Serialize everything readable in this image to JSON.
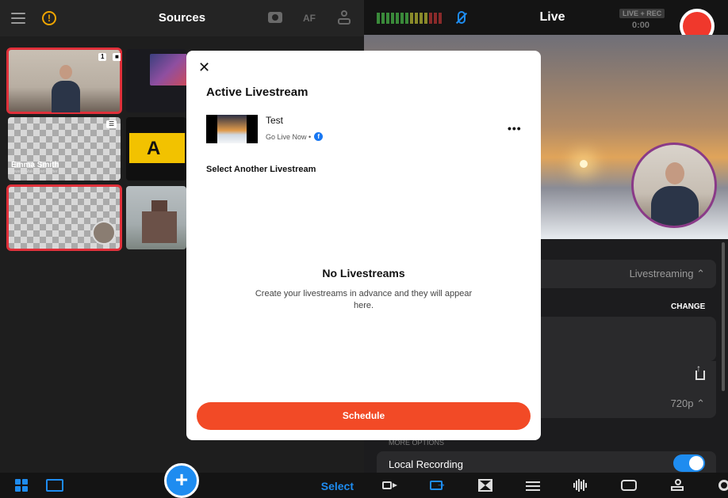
{
  "sources_panel": {
    "title": "Sources",
    "af_label": "AF",
    "tiles": [
      {
        "badge_number": "1",
        "type": "camera"
      },
      {
        "type": "screen"
      },
      {
        "type": "lower-third",
        "name": "Emma Smith",
        "subtitle": "Jewelry Maker and Crafter"
      },
      {
        "type": "graphic",
        "letter": "A"
      },
      {
        "type": "pip"
      },
      {
        "type": "image"
      }
    ],
    "select_label": "Select",
    "add_symbol": "+"
  },
  "live_panel": {
    "title": "Live",
    "badge": "LIVE + REC",
    "timer": "0:00",
    "destination_value": "Livestreaming ⌃",
    "change_label": "CHANGE",
    "resolution_value": "720p ⌃",
    "more_options_label": "MORE OPTIONS",
    "local_recording_label": "Local Recording",
    "local_recording_on": true
  },
  "modal": {
    "close_symbol": "✕",
    "heading": "Active Livestream",
    "active_stream": {
      "title": "Test",
      "subtitle": "Go Live Now •",
      "platform_icon": "facebook-icon"
    },
    "more_symbol": "•••",
    "section_heading": "Select Another Livestream",
    "empty_title": "No Livestreams",
    "empty_description": "Create your livestreams in advance and they will appear here.",
    "schedule_label": "Schedule"
  },
  "colors": {
    "accent": "#1e8cf0",
    "record": "#f0382c",
    "schedule": "#f24a26",
    "selected_outline": "#e0303a"
  }
}
